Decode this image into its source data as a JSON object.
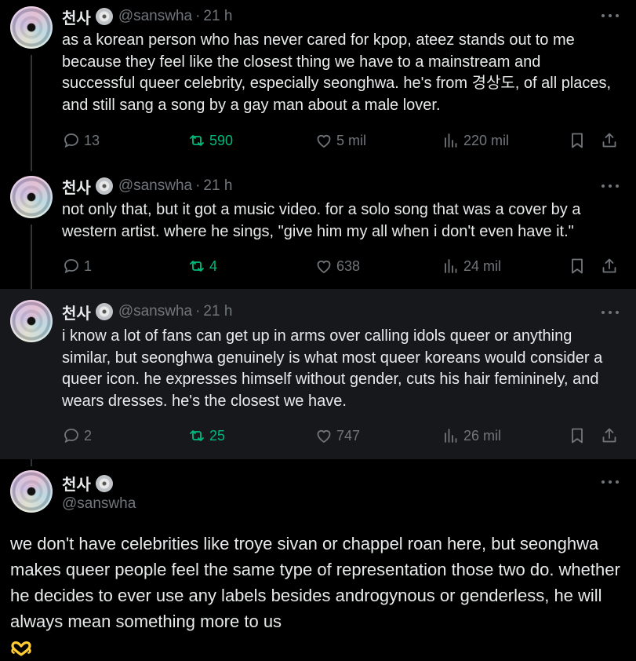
{
  "tweets": [
    {
      "name": "천사",
      "handle": "@sanswha",
      "separator": "·",
      "time": "21 h",
      "text": "as a korean person who has never cared for kpop, ateez stands out to me because they feel like the closest thing we have to a mainstream and successful queer celebrity, especially seonghwa. he's from 경상도, of all places, and still sang a song by a gay man about a male lover.",
      "replies": "13",
      "retweets": "590",
      "likes": "5 mil",
      "views": "220 mil"
    },
    {
      "name": "천사",
      "handle": "@sanswha",
      "separator": "·",
      "time": "21 h",
      "text": "not only that, but it got a music video. for a solo song that was a cover by a western artist. where he sings, \"give him my all when i don't even have it.\"",
      "replies": "1",
      "retweets": "4",
      "likes": "638",
      "views": "24 mil"
    },
    {
      "name": "천사",
      "handle": "@sanswha",
      "separator": "·",
      "time": "21 h",
      "text": "i know a lot of fans can get up in arms over calling idols queer or anything similar, but seonghwa genuinely is what most queer koreans would consider a queer icon. he expresses himself without gender, cuts his hair femininely, and wears dresses. he's the closest we have.",
      "replies": "2",
      "retweets": "25",
      "likes": "747",
      "views": "26 mil"
    }
  ],
  "main_tweet": {
    "name": "천사",
    "handle": "@sanswha",
    "text": "we don't have celebrities like troye sivan or chappel roan here, but seonghwa makes queer people feel the same type of representation those two do. whether he decides to ever use any labels besides androgynous or genderless, he will always mean something more to us",
    "emoji": "heart-hands"
  },
  "colors": {
    "background": "#000000",
    "highlight": "#16181c",
    "text": "#e7e9ea",
    "muted": "#71767b",
    "retweet_green": "#00ba7c",
    "emoji_yellow": "#ffcc33"
  }
}
